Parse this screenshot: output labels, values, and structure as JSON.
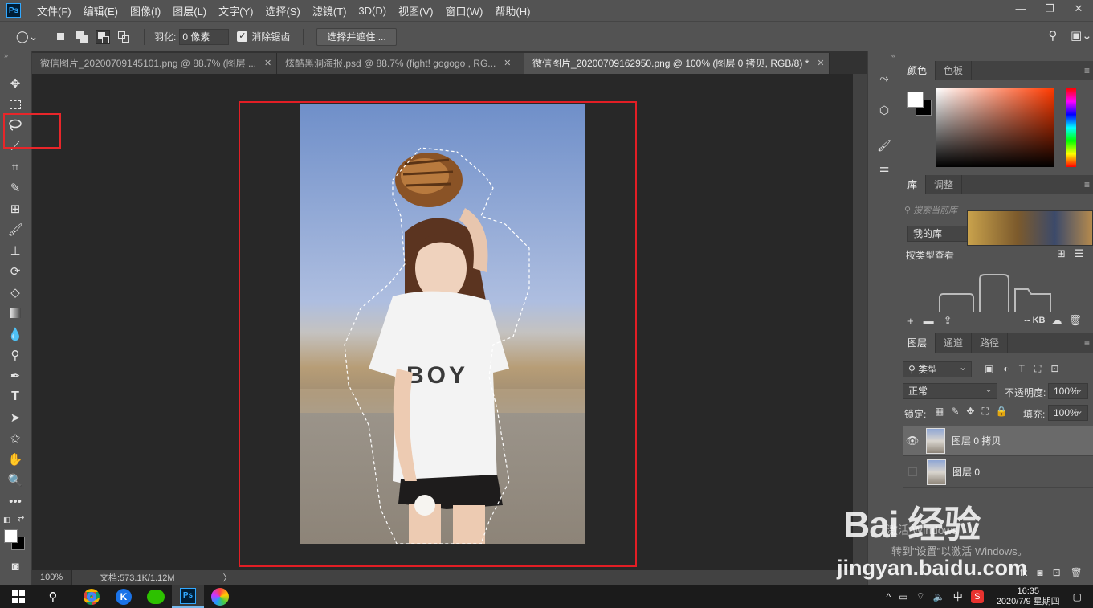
{
  "app": {
    "logo": "Ps",
    "accent": "#31a8ff"
  },
  "menu": [
    "文件(F)",
    "编辑(E)",
    "图像(I)",
    "图层(L)",
    "文字(Y)",
    "选择(S)",
    "滤镜(T)",
    "3D(D)",
    "视图(V)",
    "窗口(W)",
    "帮助(H)"
  ],
  "options": {
    "feather_label": "羽化:",
    "feather_value": "0 像素",
    "antialias_label": "消除锯齿",
    "antialias_checked": true,
    "select_mask_label": "选择并遮住 ..."
  },
  "tabs": [
    {
      "label": "微信图片_20200709145101.png @ 88.7% (图层 ...",
      "active": false
    },
    {
      "label": "炫酷黑洞海报.psd @ 88.7% (fight! gogogo , RG...",
      "active": false
    },
    {
      "label": "微信图片_20200709162950.png @ 100% (图层 0 拷贝, RGB/8) *",
      "active": true
    }
  ],
  "status": {
    "zoom": "100%",
    "doc": "文档:573.1K/1.12M",
    "arrow": "〉"
  },
  "photo": {
    "shirt_text": "BOY"
  },
  "panels": {
    "color_tabs": [
      "颜色",
      "色板"
    ],
    "library_tabs": [
      "库",
      "调整"
    ],
    "library_search_placeholder": "搜索当前库",
    "my_library": "我的库",
    "view_by_type": "按类型查看",
    "size_text": "-- KB",
    "layer_tabs": [
      "图层",
      "通道",
      "路径"
    ],
    "filter_kind": "类型",
    "blend_mode": "正常",
    "opacity_label": "不透明度:",
    "opacity_value": "100%",
    "lock_label": "锁定:",
    "fill_label": "填充:",
    "fill_value": "100%",
    "layers": [
      {
        "name": "图层 0 拷贝",
        "visible": true,
        "selected": true
      },
      {
        "name": "图层 0",
        "visible": false,
        "selected": false
      }
    ]
  },
  "taskbar": {
    "clock_time": "16:35",
    "clock_date": "2020/7/9 星期四",
    "ime": "中"
  },
  "watermark": {
    "main": "Bai 经验",
    "url": "jingyan.baidu.com",
    "activate_1": "激活 Windows",
    "activate_2": "转到\"设置\"以激活 Windows。"
  }
}
